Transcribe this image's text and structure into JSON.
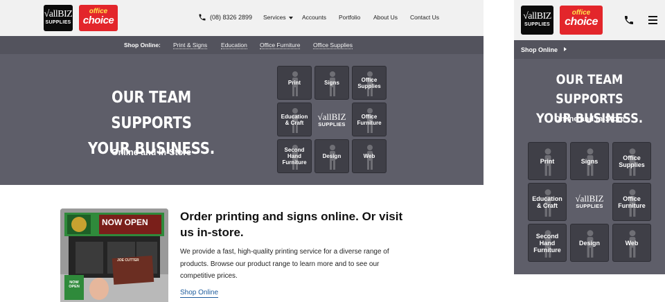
{
  "header": {
    "logo_allbiz_line1": "√allBIZ",
    "logo_allbiz_line2": "SUPPLIES",
    "logo_oc_line1": "office",
    "logo_oc_line2": "choice",
    "phone": "(08) 8326 2899",
    "nav": [
      "Services",
      "Accounts",
      "Portfolio",
      "About Us",
      "Contact Us"
    ]
  },
  "shop_bar": {
    "label": "Shop Online:",
    "links": [
      "Print & Signs",
      "Education",
      "Office Furniture",
      "Office Supplies"
    ]
  },
  "hero": {
    "title_line1": "OUR TEAM SUPPORTS",
    "title_line2": "YOUR BUSINESS.",
    "subtitle": "Online and In-Store",
    "tiles": [
      {
        "line1": "Print",
        "line2": ""
      },
      {
        "line1": "Signs",
        "line2": ""
      },
      {
        "line1": "Office",
        "line2": "Supplies"
      },
      {
        "line1": "Education",
        "line2": "& Craft"
      },
      {
        "line1": "√allBIZ",
        "line2": "SUPPLIES"
      },
      {
        "line1": "Office",
        "line2": "Furniture"
      },
      {
        "line1": "Second Hand",
        "line2": "Furniture"
      },
      {
        "line1": "Design",
        "line2": ""
      },
      {
        "line1": "Web",
        "line2": ""
      }
    ]
  },
  "promo": {
    "image_sign": "NOW OPEN",
    "image_card": "JOE CUTTER",
    "image_mini_sign": "NOW OPEN",
    "title": "Order printing and signs online. Or visit us in-store.",
    "body": "We provide a fast, high-quality printing service for a diverse range of products. Browse our product range to learn more and to see our competitive prices.",
    "link": "Shop Online"
  },
  "mobile": {
    "shop_label": "Shop Online"
  },
  "colors": {
    "hero_bg": "#5e5e69",
    "bar_bg": "#53535d",
    "tile_bg": "#3f3f47",
    "brand_red": "#e3262b",
    "link": "#1c5b9c"
  },
  "icons": [
    "phone-icon",
    "chevron-down-icon",
    "hamburger-menu-icon",
    "chevron-right-icon"
  ]
}
